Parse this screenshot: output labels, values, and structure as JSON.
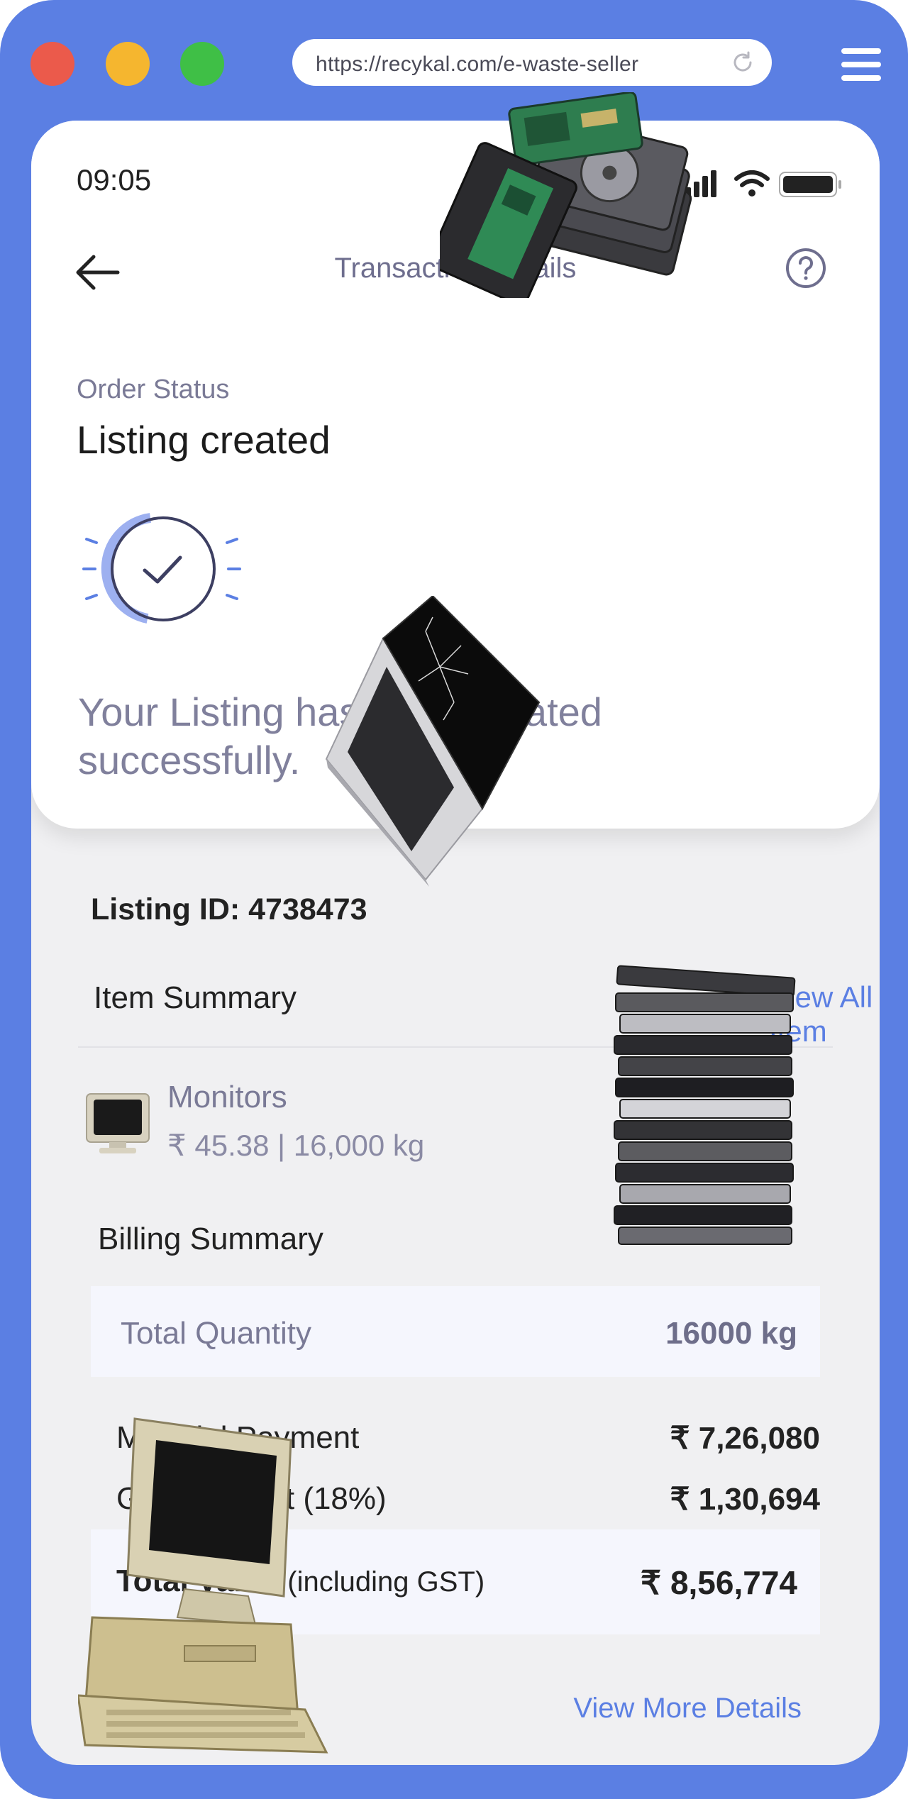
{
  "browser": {
    "url": "https://recykal.com/e-waste-seller"
  },
  "status_bar": {
    "time": "09:05"
  },
  "header": {
    "title": "Transaction Details"
  },
  "order": {
    "status_label": "Order Status",
    "status_value": "Listing created",
    "message": "Your Listing has been created successfully."
  },
  "listing": {
    "id_text": "Listing ID:  4738473"
  },
  "item_summary": {
    "title": "Item Summary",
    "view_link": "View All Item",
    "items": [
      {
        "name": "Monitors",
        "meta": "₹ 45.38  |  16,000 kg",
        "icon": "monitor-icon"
      }
    ]
  },
  "billing": {
    "title": "Billing Summary",
    "total_quantity_label": "Total Quantity",
    "total_quantity_value": "16000 kg",
    "material_payment_label": "Material Payment",
    "material_payment_value": "₹ 7,26,080",
    "gst_label": "GST Amount (18%)",
    "gst_value": "₹ 1,30,694",
    "total_value_label": "Total Value",
    "total_value_suffix": "(including GST)",
    "total_value_value": "₹ 8,56,774",
    "more_link": "View More Details"
  },
  "colors": {
    "frame": "#5b7fe3",
    "accent": "#5b7fe3",
    "muted_text": "#7a7a96",
    "card": "#ffffff",
    "background": "#f0f0f2"
  }
}
